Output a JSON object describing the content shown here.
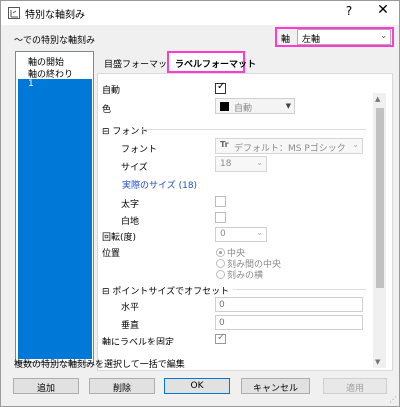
{
  "window": {
    "title": "特別な軸刻み",
    "help": "?",
    "close": "✕"
  },
  "header": {
    "list_label": "〜での特別な軸刻み",
    "axis_label": "軸",
    "axis_value": "左軸"
  },
  "ticks_list": {
    "items": [
      "軸の開始",
      "軸の終わり"
    ],
    "selected": "1"
  },
  "tabs": [
    {
      "label": "目盛フォーマット"
    },
    {
      "label": "ラベルフォーマット"
    }
  ],
  "form": {
    "auto_label": "自動",
    "color_label": "色",
    "color_value": "自動",
    "color_hex": "#000000",
    "font_section": "フォント",
    "font_label": "フォント",
    "font_value": "デフォルト：MS Pゴシック",
    "size_label": "サイズ",
    "size_value": "18",
    "actual_size": "実際のサイズ (18)",
    "bold_label": "太字",
    "white_bg_label": "白地",
    "rotation_label": "回転(度)",
    "rotation_value": "0",
    "position_label": "位置",
    "position_options": [
      "中央",
      "刻み間の中央",
      "刻みの横"
    ],
    "offset_section": "ポイントサイズでオフセット",
    "horizontal_label": "水平",
    "horizontal_value": "0",
    "vertical_label": "垂直",
    "vertical_value": "0",
    "fix_label": "軸にラベルを固定"
  },
  "footer": {
    "hint": "複数の特別な軸刻みを選択して一括で編集",
    "add": "追加",
    "delete": "削除",
    "ok": "OK",
    "cancel": "キャンセル",
    "apply": "適用"
  }
}
